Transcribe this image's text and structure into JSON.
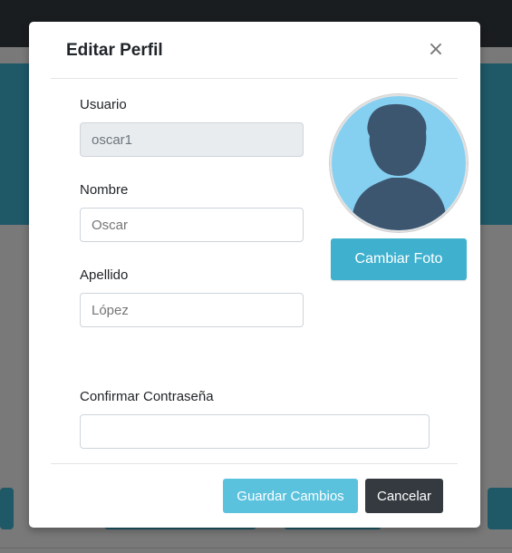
{
  "modal": {
    "title": "Editar Perfil",
    "close_symbol": "×",
    "fields": {
      "usuario": {
        "label": "Usuario",
        "value": "oscar1"
      },
      "nombre": {
        "label": "Nombre",
        "placeholder": "Oscar"
      },
      "apellido": {
        "label": "Apellido",
        "placeholder": "López"
      },
      "confirmar": {
        "label": "Confirmar Contraseña",
        "value": ""
      }
    },
    "change_photo_label": "Cambiar Foto",
    "footer": {
      "save_label": "Guardar Cambios",
      "cancel_label": "Cancelar"
    }
  },
  "icons": {
    "close": "close-icon",
    "avatar": "user-silhouette-icon"
  },
  "colors": {
    "info": "#3fb1cf",
    "save": "#5bc2de",
    "dark": "#343a40",
    "avatar_bg": "#85cff0",
    "avatar_figure": "#3d5670"
  }
}
